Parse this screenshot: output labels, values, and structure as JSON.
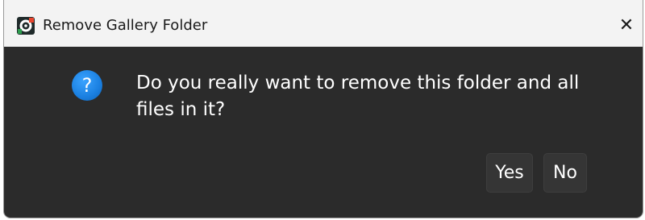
{
  "window": {
    "title": "Remove Gallery Folder",
    "close_glyph": "✕"
  },
  "app_icon": "eye-camera-icon",
  "dialog": {
    "icon": "question-icon",
    "icon_glyph": "?",
    "message": "Do you really want to remove this folder and all files in it?",
    "buttons": {
      "yes": "Yes",
      "no": "No"
    }
  },
  "colors": {
    "background": "#2b2b2b",
    "titlebar": "#f3f3f3",
    "question_icon": "#1a7fe0",
    "button": "#353535"
  }
}
